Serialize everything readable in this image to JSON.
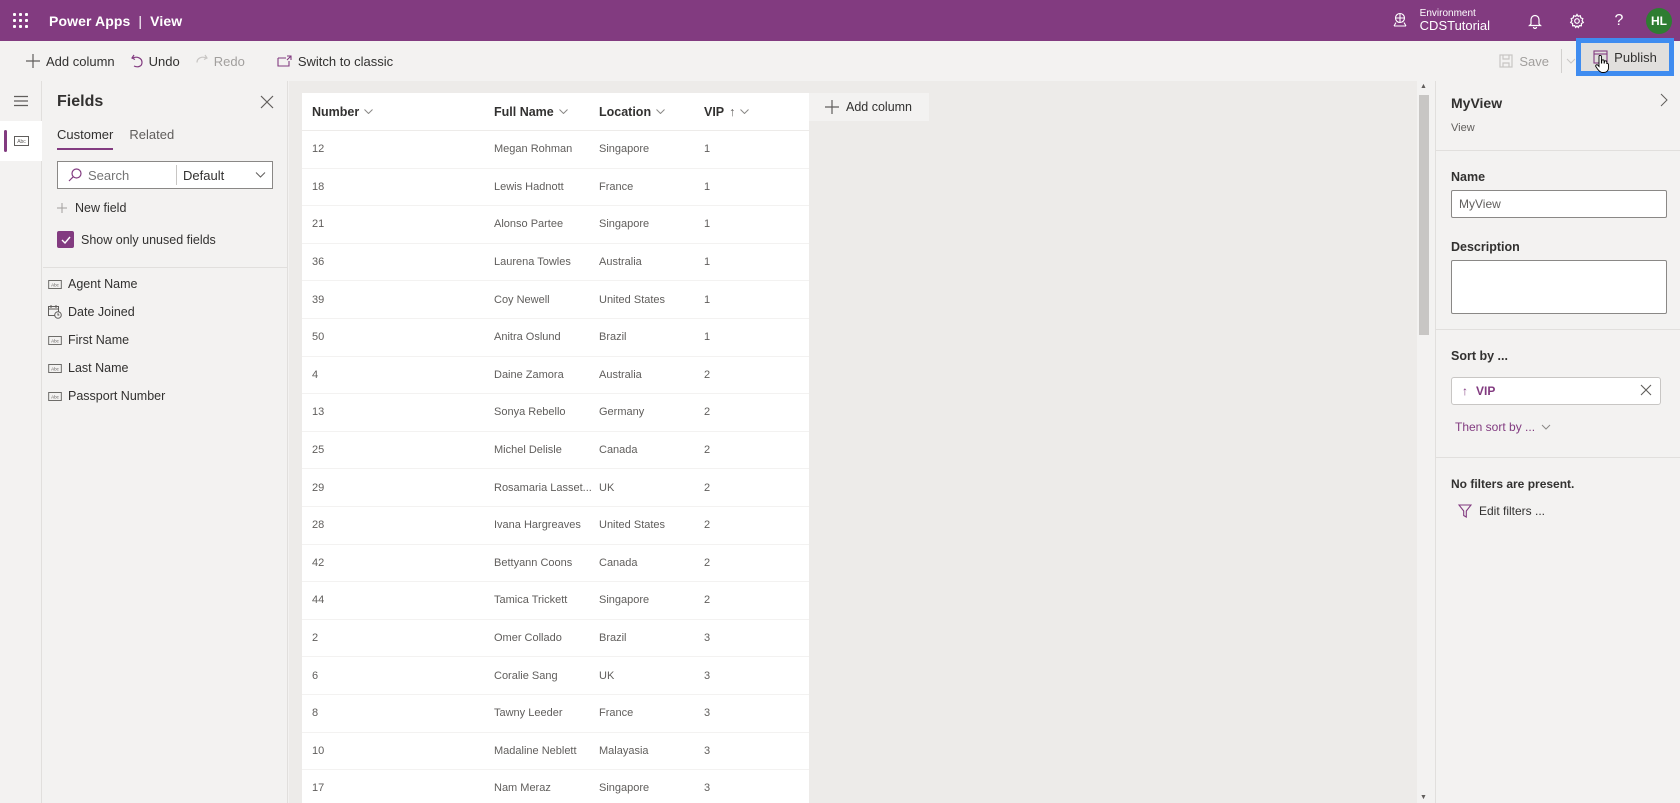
{
  "topbar": {
    "app_name": "Power Apps",
    "separator": "|",
    "page_name": "View",
    "environment_label": "Environment",
    "environment_name": "CDSTutorial",
    "avatar_initials": "HL",
    "icons": [
      "waffle-icon",
      "environment-icon",
      "notification-bell-icon",
      "settings-gear-icon",
      "help-icon"
    ]
  },
  "commandbar": {
    "add_column": "Add column",
    "undo": "Undo",
    "redo": "Redo",
    "switch_classic": "Switch to classic",
    "save": "Save",
    "publish": "Publish"
  },
  "fields_panel": {
    "title": "Fields",
    "tabs": [
      {
        "label": "Customer",
        "active": true
      },
      {
        "label": "Related",
        "active": false
      }
    ],
    "search_placeholder": "Search",
    "filter_select": "Default",
    "new_field": "New field",
    "show_unused_label": "Show only unused fields",
    "show_unused_checked": true,
    "items": [
      {
        "label": "Agent Name",
        "icon": "text-field-icon"
      },
      {
        "label": "Date Joined",
        "icon": "date-field-icon"
      },
      {
        "label": "First Name",
        "icon": "text-field-icon"
      },
      {
        "label": "Last Name",
        "icon": "text-field-icon"
      },
      {
        "label": "Passport Number",
        "icon": "text-field-icon"
      }
    ]
  },
  "grid": {
    "columns": [
      {
        "label": "Number",
        "sort": ""
      },
      {
        "label": "Full Name",
        "sort": ""
      },
      {
        "label": "Location",
        "sort": ""
      },
      {
        "label": "VIP",
        "sort": "↑"
      }
    ],
    "add_column": "Add column",
    "rows": [
      [
        "12",
        "Megan Rohman",
        "Singapore",
        "1"
      ],
      [
        "18",
        "Lewis Hadnott",
        "France",
        "1"
      ],
      [
        "21",
        "Alonso Partee",
        "Singapore",
        "1"
      ],
      [
        "36",
        "Laurena Towles",
        "Australia",
        "1"
      ],
      [
        "39",
        "Coy Newell",
        "United States",
        "1"
      ],
      [
        "50",
        "Anitra Oslund",
        "Brazil",
        "1"
      ],
      [
        "4",
        "Daine Zamora",
        "Australia",
        "2"
      ],
      [
        "13",
        "Sonya Rebello",
        "Germany",
        "2"
      ],
      [
        "25",
        "Michel Delisle",
        "Canada",
        "2"
      ],
      [
        "29",
        "Rosamaria Lasset...",
        "UK",
        "2"
      ],
      [
        "28",
        "Ivana Hargreaves",
        "United States",
        "2"
      ],
      [
        "42",
        "Bettyann Coons",
        "Canada",
        "2"
      ],
      [
        "44",
        "Tamica Trickett",
        "Singapore",
        "2"
      ],
      [
        "2",
        "Omer Collado",
        "Brazil",
        "3"
      ],
      [
        "6",
        "Coralie Sang",
        "UK",
        "3"
      ],
      [
        "8",
        "Tawny Leeder",
        "France",
        "3"
      ],
      [
        "10",
        "Madaline Neblett",
        "Malayasia",
        "3"
      ],
      [
        "17",
        "Nam Meraz",
        "Singapore",
        "3"
      ]
    ]
  },
  "properties": {
    "title": "MyView",
    "subtitle": "View",
    "name_label": "Name",
    "name_value": "MyView",
    "description_label": "Description",
    "description_value": "",
    "sort_label": "Sort by ...",
    "sort_field": "VIP",
    "sort_direction": "↑",
    "then_sort": "Then sort by ...",
    "no_filters": "No filters are present.",
    "edit_filters": "Edit filters ..."
  },
  "colors": {
    "brand": "#823b80",
    "highlight": "#3f8cf0",
    "avatar": "#2e7d32"
  }
}
